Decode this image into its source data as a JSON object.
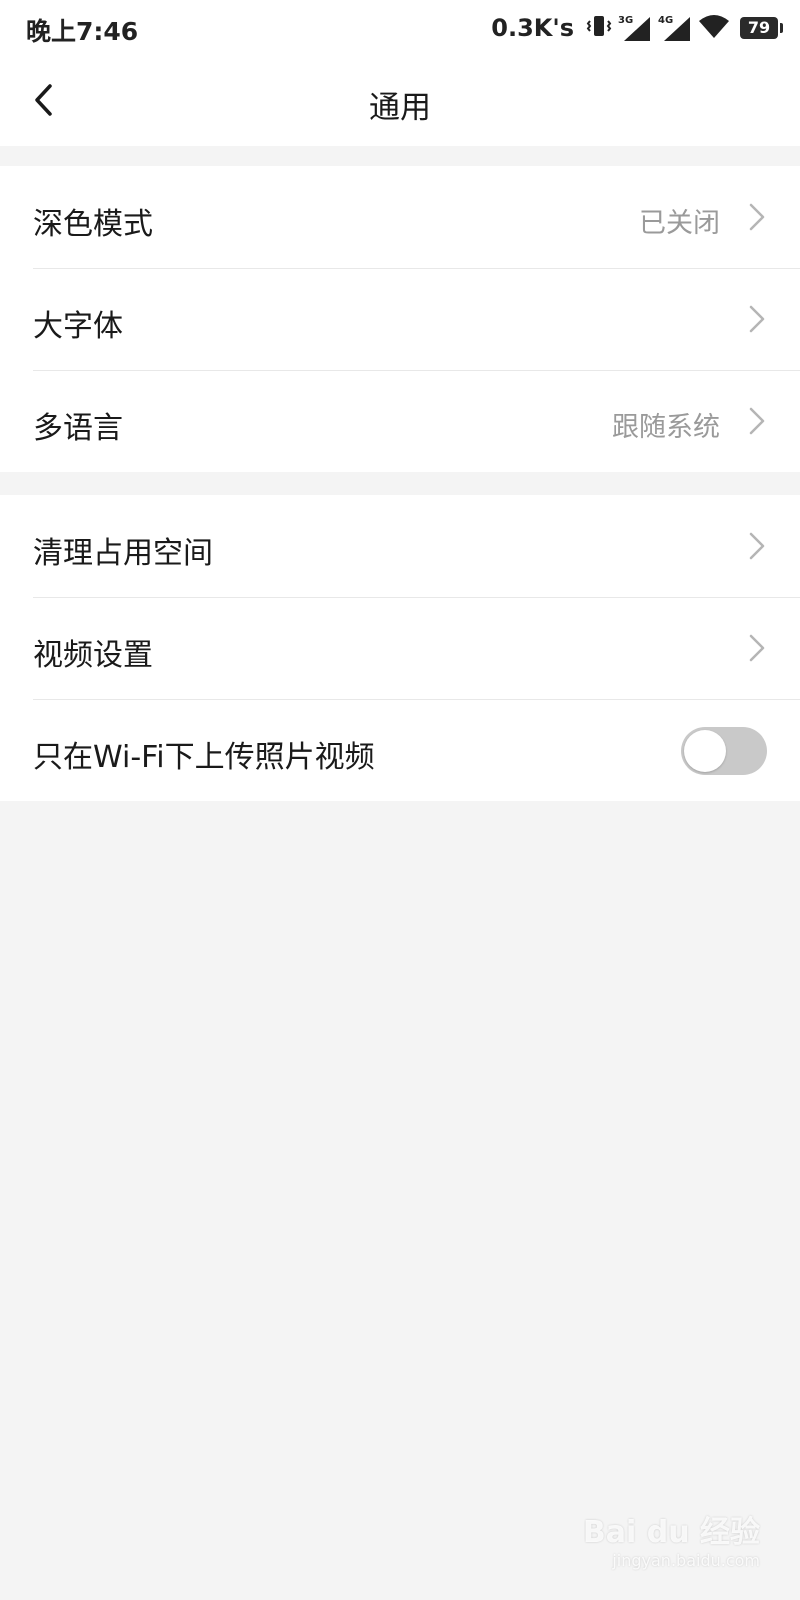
{
  "status_bar": {
    "time": "晚上7:46",
    "net_speed": "0.3K's",
    "sim1_label": "3G",
    "sim2_label": "4G",
    "battery": "79",
    "icons": [
      "vibrate-icon",
      "signal-3g-icon",
      "signal-4g-icon",
      "wifi-icon",
      "battery-icon"
    ]
  },
  "header": {
    "back_icon": "chevron-left-icon",
    "title": "通用"
  },
  "settings": {
    "group1": [
      {
        "label": "深色模式",
        "value": "已关闭"
      },
      {
        "label": "大字体",
        "value": ""
      },
      {
        "label": "多语言",
        "value": "跟随系统"
      }
    ],
    "group2": [
      {
        "label": "清理占用空间"
      },
      {
        "label": "视频设置"
      },
      {
        "label": "只在Wi-Fi下上传照片视频",
        "toggle_on": false
      }
    ]
  },
  "watermark": {
    "brand": "Bai du 经验",
    "url": "jingyan.baidu.com"
  },
  "colors": {
    "background": "#f4f4f4",
    "card": "#ffffff",
    "text": "#1a1a1a",
    "secondary_text": "#9a9a9a",
    "toggle_off": "#c9c9c9"
  }
}
